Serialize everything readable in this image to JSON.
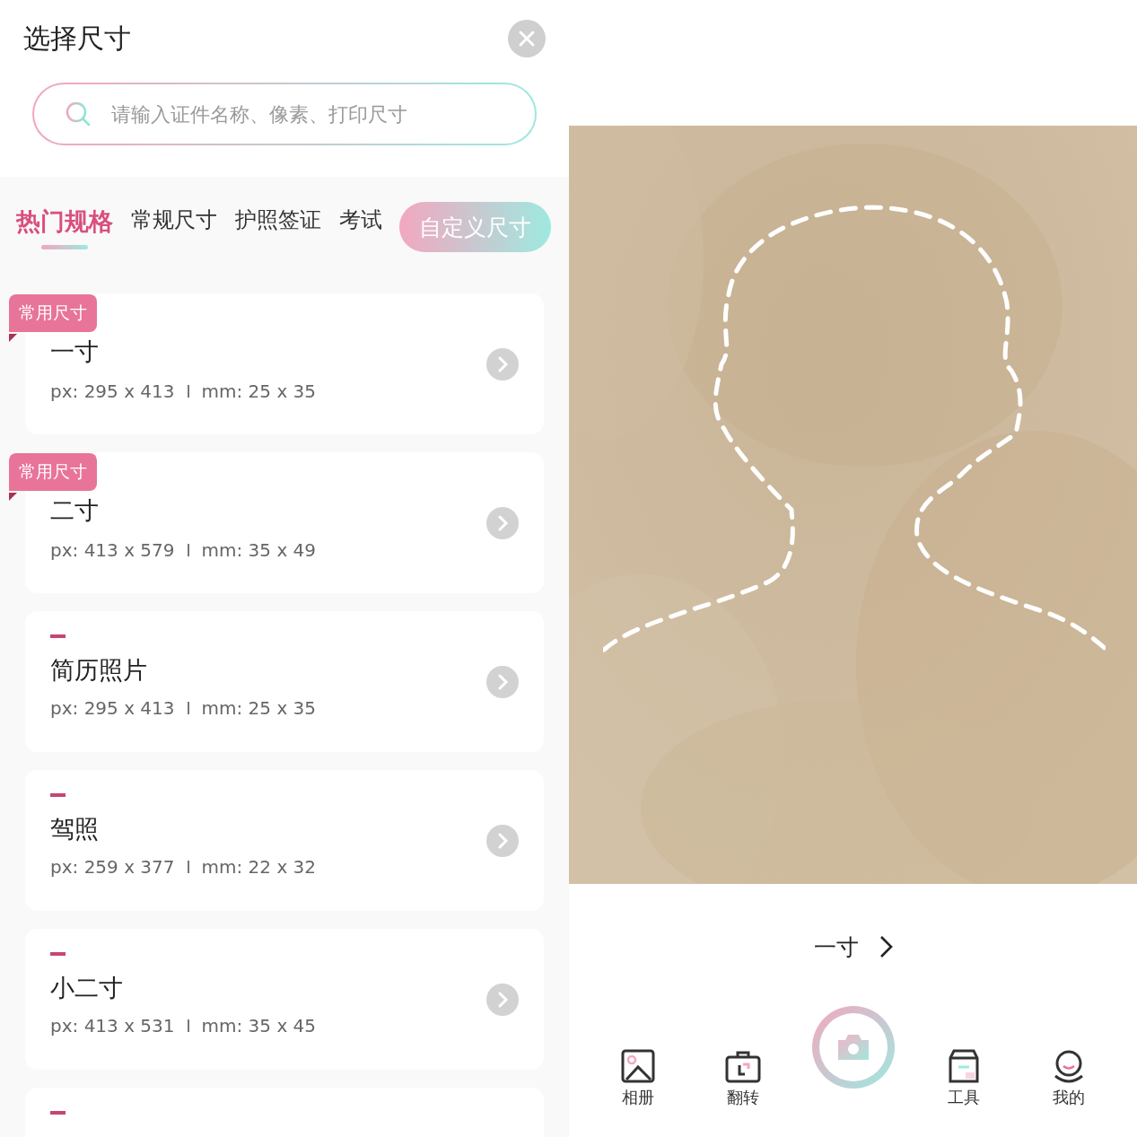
{
  "header": {
    "title": "选择尺寸"
  },
  "search": {
    "placeholder": "请输入证件名称、像素、打印尺寸"
  },
  "tabs": [
    {
      "label": "热门规格",
      "selected": true
    },
    {
      "label": "常规尺寸",
      "selected": false
    },
    {
      "label": "护照签证",
      "selected": false
    },
    {
      "label": "考试",
      "selected": false
    }
  ],
  "custom_size_button": "自定义尺寸",
  "sizes": [
    {
      "kind": "badge",
      "badge": "常用尺寸",
      "name": "一寸",
      "px": "px: 295 x 413",
      "mm": "mm: 25 x 35"
    },
    {
      "kind": "badge",
      "badge": "常用尺寸",
      "name": "二寸",
      "px": "px: 413 x 579",
      "mm": "mm: 35 x 49"
    },
    {
      "kind": "dash",
      "name": "简历照片",
      "px": "px: 295 x 413",
      "mm": "mm: 25 x 35"
    },
    {
      "kind": "dash",
      "name": "驾照",
      "px": "px: 259 x 377",
      "mm": "mm: 22 x 32"
    },
    {
      "kind": "dash",
      "name": "小二寸",
      "px": "px: 413 x 531",
      "mm": "mm: 35 x 45"
    },
    {
      "kind": "dash"
    }
  ],
  "size_selector": {
    "label": "一寸"
  },
  "nav": [
    {
      "kind": "album",
      "label": "相册"
    },
    {
      "kind": "flip",
      "label": "翻转"
    },
    {
      "kind": "shutter"
    },
    {
      "kind": "tools",
      "label": "工具"
    },
    {
      "kind": "me",
      "label": "我的"
    }
  ]
}
